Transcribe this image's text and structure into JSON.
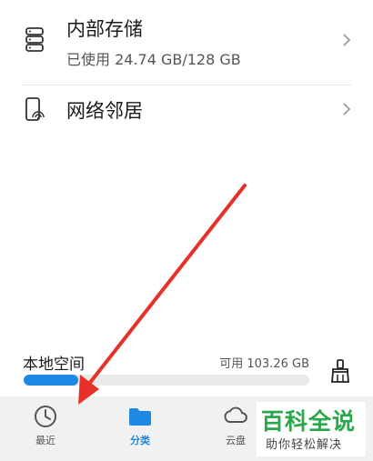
{
  "list": {
    "internal_storage": {
      "title": "内部存储",
      "subtitle": "已使用 24.74 GB/128 GB",
      "icon": "storage-icon"
    },
    "network_neighborhood": {
      "title": "网络邻居",
      "icon": "network-device-icon"
    }
  },
  "storage_bar": {
    "title": "本地空间",
    "available": "可用 103.26 GB",
    "used_fraction": 0.19,
    "clean_icon": "broom-icon"
  },
  "bottom_nav": {
    "recent": {
      "label": "最近",
      "icon": "clock-icon"
    },
    "categories": {
      "label": "分类",
      "icon": "folder-icon",
      "active": true
    },
    "cloud": {
      "label": "云盘",
      "icon": "cloud-icon"
    }
  },
  "watermark": {
    "title": "百科全说",
    "subtitle": "助你轻松解决"
  },
  "colors": {
    "accent": "#1e88e5",
    "annotation_arrow": "#e8302b",
    "watermark_green": "#2aa74a"
  }
}
